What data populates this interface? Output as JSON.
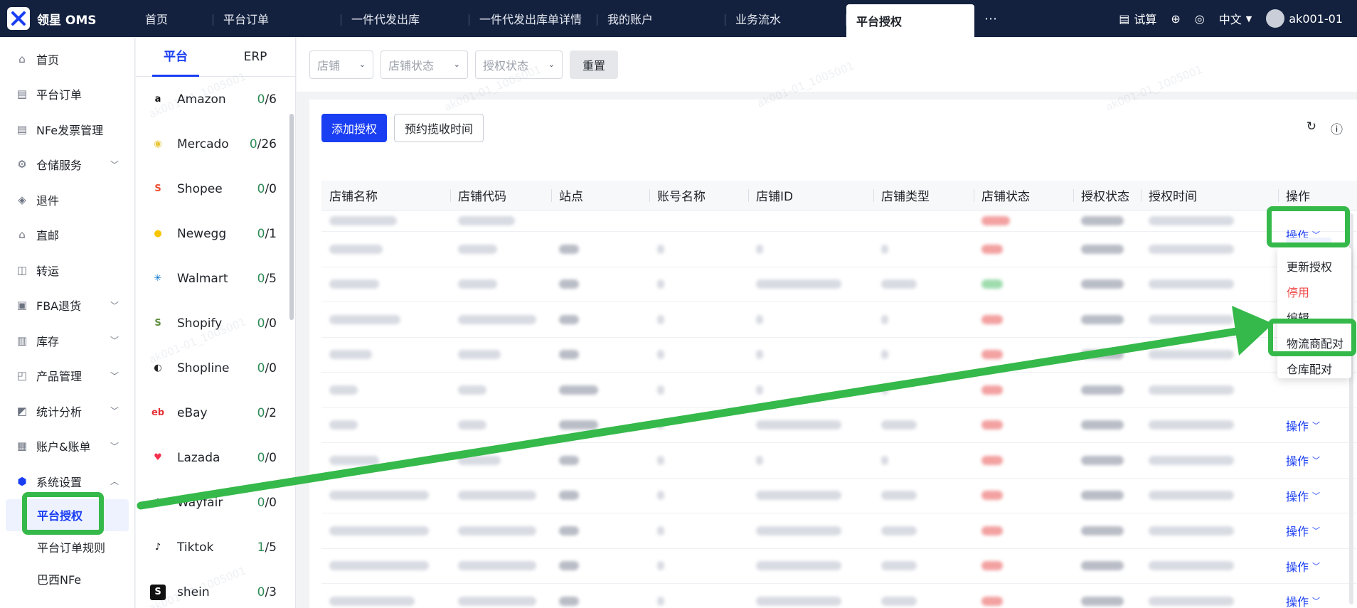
{
  "app": {
    "title": "领星 OMS"
  },
  "tabs": [
    "首页",
    "平台订单",
    "一件代发出库",
    "一件代发出库单详情",
    "我的账户",
    "业务流水",
    "平台授权"
  ],
  "active_tab": "平台授权",
  "top_right": {
    "trial": "试算",
    "lang": "中文",
    "user": "ak001-01"
  },
  "nav": {
    "items": [
      {
        "label": "首页",
        "icon": "home-icon",
        "chevron": false
      },
      {
        "label": "平台订单",
        "icon": "document-icon",
        "chevron": false
      },
      {
        "label": "NFe发票管理",
        "icon": "invoice-icon",
        "chevron": false
      },
      {
        "label": "仓储服务",
        "icon": "warehouse-service-icon",
        "chevron": true
      },
      {
        "label": "退件",
        "icon": "return-icon",
        "chevron": false
      },
      {
        "label": "直邮",
        "icon": "direct-mail-icon",
        "chevron": false
      },
      {
        "label": "转运",
        "icon": "transfer-icon",
        "chevron": false
      },
      {
        "label": "FBA退货",
        "icon": "fba-return-icon",
        "chevron": true
      },
      {
        "label": "库存",
        "icon": "inventory-icon",
        "chevron": true
      },
      {
        "label": "产品管理",
        "icon": "product-icon",
        "chevron": true
      },
      {
        "label": "统计分析",
        "icon": "stats-icon",
        "chevron": true
      },
      {
        "label": "账户&账单",
        "icon": "account-icon",
        "chevron": true
      },
      {
        "label": "系统设置",
        "icon": "settings-icon",
        "chevron": true
      }
    ],
    "sub_items": [
      "平台授权",
      "平台订单规则",
      "巴西NFe"
    ]
  },
  "platform_panel": {
    "tabs": [
      "平台",
      "ERP"
    ],
    "items": [
      {
        "name": "Amazon",
        "authorized": "0",
        "total": "/6",
        "logo": "amazon-icon",
        "color": "#111"
      },
      {
        "name": "Mercado",
        "authorized": "0",
        "total": "/26",
        "logo": "mercado-icon",
        "color": "#e8c53a"
      },
      {
        "name": "Shopee",
        "authorized": "0",
        "total": "/0",
        "logo": "shopee-icon",
        "color": "#ee4d2d"
      },
      {
        "name": "Newegg",
        "authorized": "0",
        "total": "/1",
        "logo": "newegg-icon",
        "color": "#f7c600"
      },
      {
        "name": "Walmart",
        "authorized": "0",
        "total": "/5",
        "logo": "walmart-icon",
        "color": "#0071ce"
      },
      {
        "name": "Shopify",
        "authorized": "0",
        "total": "/0",
        "logo": "shopify-icon",
        "color": "#5e8e3e"
      },
      {
        "name": "Shopline",
        "authorized": "0",
        "total": "/0",
        "logo": "shopline-icon",
        "color": "#222"
      },
      {
        "name": "eBay",
        "authorized": "0",
        "total": "/2",
        "logo": "ebay-icon",
        "color": "#e53238"
      },
      {
        "name": "Lazada",
        "authorized": "0",
        "total": "/0",
        "logo": "lazada-icon",
        "color": "#f5314c"
      },
      {
        "name": "Wayfair",
        "authorized": "0",
        "total": "/0",
        "logo": "wayfair-icon",
        "color": "#7f187f"
      },
      {
        "name": "Tiktok",
        "authorized": "1",
        "total": "/5",
        "logo": "tiktok-icon",
        "color": "#111"
      },
      {
        "name": "shein",
        "authorized": "0",
        "total": "/3",
        "logo": "shein-icon",
        "color": "#111"
      }
    ]
  },
  "filters": {
    "store": "店铺",
    "store_status": "店铺状态",
    "auth_status": "授权状态",
    "reset": "重置"
  },
  "toolbar": {
    "add": "添加授权",
    "schedule": "预约揽收时间"
  },
  "table": {
    "columns": [
      "店铺名称",
      "店铺代码",
      "站点",
      "账号名称",
      "店铺ID",
      "店铺类型",
      "店铺状态",
      "授权状态",
      "授权时间",
      "操作"
    ],
    "op_label": "操作"
  },
  "dropdown": {
    "items": [
      "更新授权",
      "停用",
      "编辑",
      "物流商配对",
      "仓库配对"
    ]
  },
  "watermark": "ak001-01_1005001",
  "colors": {
    "accent": "#1a3ef2",
    "topbar": "#13213f",
    "annotation": "#35b94a",
    "danger": "#f04a4a"
  }
}
